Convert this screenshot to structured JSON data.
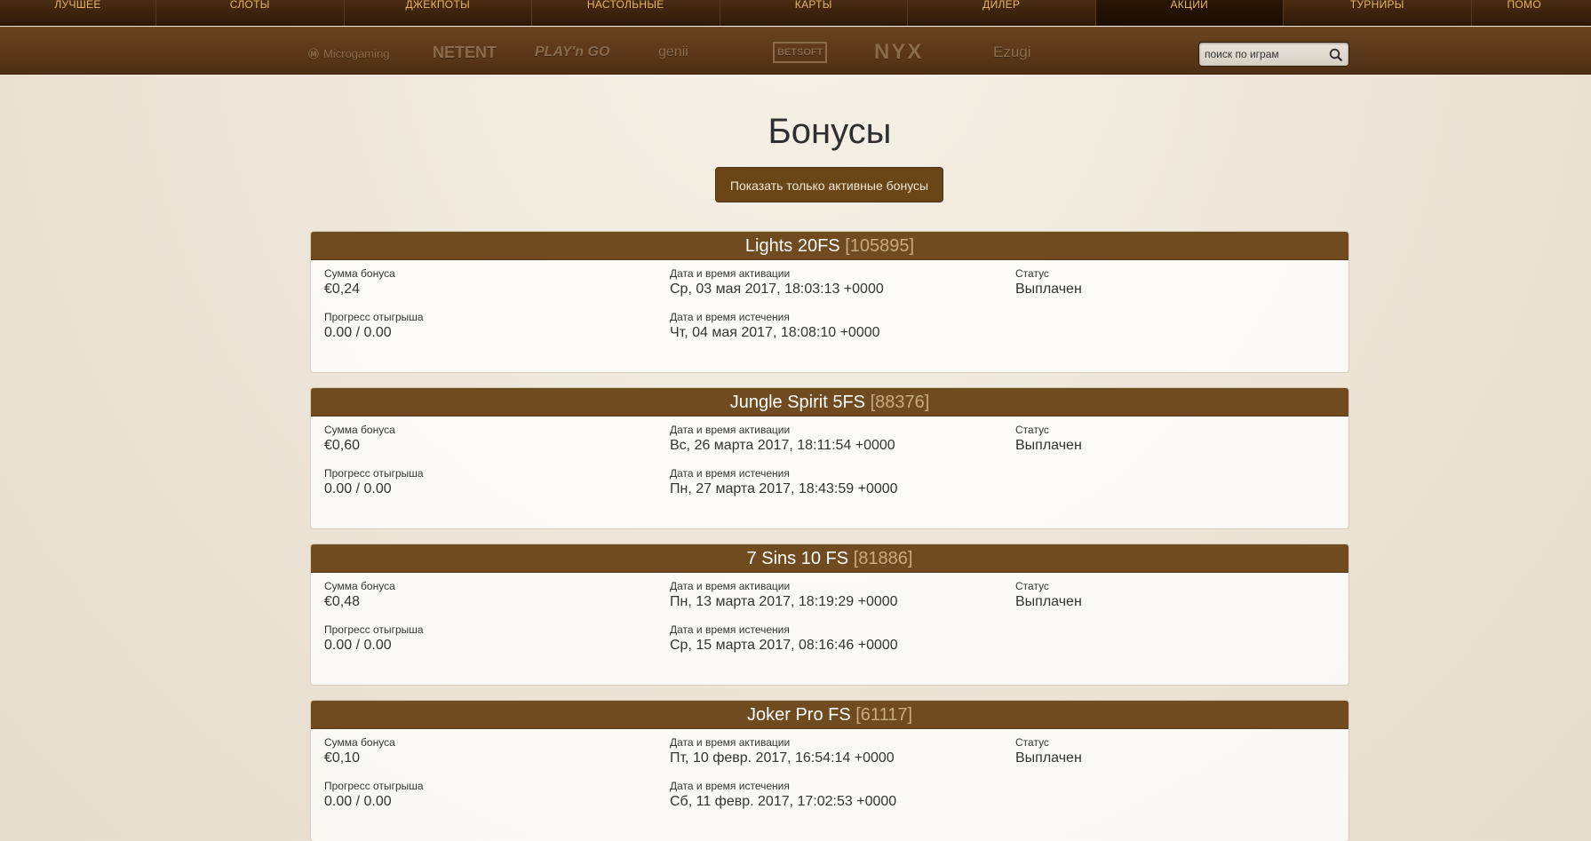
{
  "nav": {
    "items": [
      {
        "label": "Лучшее",
        "active": false
      },
      {
        "label": "Слоты",
        "active": false
      },
      {
        "label": "Джекпоты",
        "active": false
      },
      {
        "label": "Настольные",
        "active": false
      },
      {
        "label": "Карты",
        "active": false
      },
      {
        "label": "Дилер",
        "active": false
      },
      {
        "label": "Акции",
        "active": true
      },
      {
        "label": "Турниры",
        "active": false
      },
      {
        "label": "Помо",
        "active": false
      }
    ]
  },
  "providers": [
    "Microgaming",
    "NETENT",
    "PLAY'n GO",
    "genii",
    "BETSOFT",
    "NYX",
    "Ezugi"
  ],
  "search": {
    "placeholder": "поиск по играм"
  },
  "page_title": "Бонусы",
  "filter_button": "Показать только активные бонусы",
  "labels": {
    "amount": "Сумма бонуса",
    "activation": "Дата и время активации",
    "status": "Статус",
    "progress": "Прогресс отыгрыша",
    "expiry": "Дата и время истечения"
  },
  "bonuses": [
    {
      "name": "Lights 20FS",
      "id": "[105895]",
      "amount": "€0,24",
      "activation": "Ср, 03 мая 2017, 18:03:13 +0000",
      "status": "Выплачен",
      "progress": "0.00 / 0.00",
      "expiry": "Чт, 04 мая 2017, 18:08:10 +0000"
    },
    {
      "name": "Jungle Spirit 5FS",
      "id": "[88376]",
      "amount": "€0,60",
      "activation": "Вс, 26 марта 2017, 18:11:54 +0000",
      "status": "Выплачен",
      "progress": "0.00 / 0.00",
      "expiry": "Пн, 27 марта 2017, 18:43:59 +0000"
    },
    {
      "name": "7 Sins 10 FS",
      "id": "[81886]",
      "amount": "€0,48",
      "activation": "Пн, 13 марта 2017, 18:19:29 +0000",
      "status": "Выплачен",
      "progress": "0.00 / 0.00",
      "expiry": "Ср, 15 марта 2017, 08:16:46 +0000"
    },
    {
      "name": "Joker Pro FS",
      "id": "[61117]",
      "amount": "€0,10",
      "activation": "Пт, 10 февр. 2017, 16:54:14 +0000",
      "status": "Выплачен",
      "progress": "0.00 / 0.00",
      "expiry": "Сб, 11 февр. 2017, 17:02:53 +0000"
    }
  ],
  "colors": {
    "header_brown": "#704b1f",
    "nav_gold": "#e6b46a",
    "button_brown": "#6a4518"
  }
}
